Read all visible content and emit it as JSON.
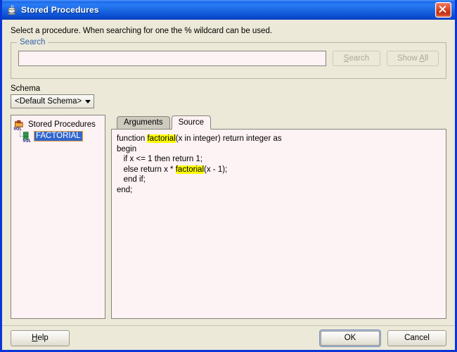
{
  "window": {
    "title": "Stored Procedures",
    "title_icon": "java-coffee-cup-icon",
    "close_icon": "close-icon"
  },
  "instruction": "Select a procedure. When searching for one the % wildcard can be used.",
  "search": {
    "group_label": "Search",
    "input_value": "",
    "input_placeholder": "",
    "search_button": "Search",
    "search_button_mnemonic": "S",
    "search_button_rest": "earch",
    "show_all_button": "Show All",
    "show_all_prefix": "Show ",
    "show_all_mnemonic": "A",
    "show_all_rest": "ll",
    "search_enabled": false,
    "show_all_enabled": false
  },
  "schema": {
    "label": "Schema",
    "selected": "<Default Schema>",
    "caret_icon": "chevron-down-icon"
  },
  "tree": {
    "root": {
      "label": "Stored Procedures",
      "icon": "folder-sql-icon"
    },
    "children": [
      {
        "label": "FACTORIAL",
        "icon": "procedure-sql-icon",
        "selected": true
      }
    ]
  },
  "tabs": [
    {
      "label": "Arguments",
      "active": false
    },
    {
      "label": "Source",
      "active": true
    }
  ],
  "source": {
    "language": "plsql",
    "highlight_term": "factorial",
    "lines": [
      [
        {
          "t": "function ",
          "h": false
        },
        {
          "t": "factorial",
          "h": true
        },
        {
          "t": "(x in integer) return integer as",
          "h": false
        }
      ],
      [
        {
          "t": "begin",
          "h": false
        }
      ],
      [
        {
          "t": "   if x <= 1 then return 1;",
          "h": false
        }
      ],
      [
        {
          "t": "   else return x * ",
          "h": false
        },
        {
          "t": "factorial",
          "h": true
        },
        {
          "t": "(x - 1);",
          "h": false
        }
      ],
      [
        {
          "t": "   end if;",
          "h": false
        }
      ],
      [
        {
          "t": "end;",
          "h": false
        }
      ]
    ],
    "plain_text": "function factorial(x in integer) return integer as\nbegin\n   if x <= 1 then return 1;\n   else return x * factorial(x - 1);\n   end if;\nend;"
  },
  "footer": {
    "help_button": "Help",
    "help_mnemonic": "H",
    "help_prefix": "",
    "help_rest": "elp",
    "ok_button": "OK",
    "cancel_button": "Cancel",
    "default_button": "OK"
  },
  "colors": {
    "titlebar_blue": "#1a66e8",
    "window_border": "#0a36d8",
    "dialog_face": "#ece9d8",
    "field_background": "#fdf2f4",
    "group_label_blue": "#2f5fa8",
    "selection_blue": "#3366cc",
    "selection_border_orange": "#e8a33d",
    "highlight_yellow": "#ffff00",
    "disabled_text": "#aba89c",
    "close_red": "#c32d10"
  }
}
